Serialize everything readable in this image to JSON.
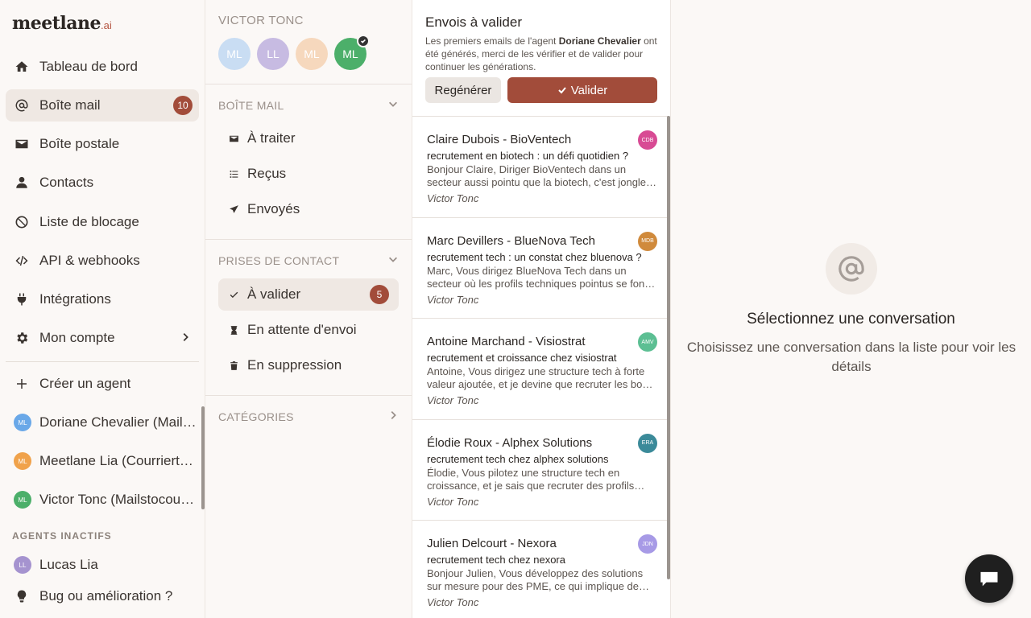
{
  "brand": {
    "name": "meetlane",
    "suffix": ".ai"
  },
  "sidebar": {
    "nav": [
      {
        "label": "Tableau de bord",
        "icon": "home-icon"
      },
      {
        "label": "Boîte mail",
        "icon": "at-icon",
        "badge": "10"
      },
      {
        "label": "Boîte postale",
        "icon": "mail-icon"
      },
      {
        "label": "Contacts",
        "icon": "user-icon"
      },
      {
        "label": "Liste de blocage",
        "icon": "block-icon"
      },
      {
        "label": "API & webhooks",
        "icon": "code-icon"
      },
      {
        "label": "Intégrations",
        "icon": "plug-icon"
      },
      {
        "label": "Mon compte",
        "icon": "gear-icon"
      }
    ],
    "create_agent": "Créer un agent",
    "agents": [
      {
        "initials": "ML",
        "label": "Doriane Chevalier (Mailstocoucou)",
        "color": "#6aa8e8"
      },
      {
        "initials": "ML",
        "label": "Meetlane Lia (Courriertech)",
        "color": "#f0a24b"
      },
      {
        "initials": "ML",
        "label": "Victor Tonc (Mailstocoucou)",
        "color": "#4caf6a"
      }
    ],
    "inactive_caption": "AGENTS INACTIFS",
    "inactive_agents": [
      {
        "initials": "LL",
        "label": "Lucas Lia",
        "color": "#a593cf"
      }
    ],
    "feedback": "Bug ou amélioration ?"
  },
  "panel": {
    "title": "VICTOR TONC",
    "avatars": [
      {
        "initials": "ML",
        "color": "#c9ddf3"
      },
      {
        "initials": "LL",
        "color": "#c7bbe2"
      },
      {
        "initials": "ML",
        "color": "#f6d8bd"
      },
      {
        "initials": "ML",
        "color": "#4caf6a"
      }
    ],
    "mailbox_caption": "BOÎTE MAIL",
    "mailbox_items": [
      "À traiter",
      "Reçus",
      "Envoyés"
    ],
    "contacts_caption": "PRISES DE CONTACT",
    "contact_items": [
      {
        "label": "À valider",
        "badge": "5"
      },
      {
        "label": "En attente d'envoi"
      },
      {
        "label": "En suppression"
      }
    ],
    "categories_caption": "CATÉGORIES"
  },
  "validation": {
    "title": "Envois à valider",
    "desc_before": "Les premiers emails de l'agent ",
    "desc_agent": "Doriane Chevalier",
    "desc_after": " ont été générés, merci de les vérifier et de valider pour continuer les générations.",
    "regen_label": "Regénérer",
    "validate_label": "Valider"
  },
  "mails": [
    {
      "from": "Claire Dubois - BioVentech",
      "subject": "recrutement en biotech : un défi quotidien ?",
      "preview": "Bonjour Claire, Diriger BioVentech dans un secteur aussi pointu que la biotech, c'est jongler avec des talents rares.",
      "signature": "Victor Tonc",
      "initials": "CDB",
      "color": "#d84b94"
    },
    {
      "from": "Marc Devillers - BlueNova Tech",
      "subject": "recrutement tech : un constat chez bluenova ?",
      "preview": "Marc, Vous dirigez BlueNova Tech dans un secteur où les profils techniques pointus se font rares.",
      "signature": "Victor Tonc",
      "initials": "MDB",
      "color": "#d08a3c"
    },
    {
      "from": "Antoine Marchand - Visiostrat",
      "subject": "recrutement et croissance chez visiostrat",
      "preview": "Antoine, Vous dirigez une structure tech à forte valeur ajoutée, et je devine que recruter les bons profils prend du temps.",
      "signature": "Victor Tonc",
      "initials": "AMV",
      "color": "#5cbf93"
    },
    {
      "from": "Élodie Roux - Alphex Solutions",
      "subject": "recrutement tech chez alphex solutions",
      "preview": "Élodie, Vous pilotez une structure tech en croissance, et je sais que recruter des profils qualifiés reste un défi.",
      "signature": "Victor Tonc",
      "initials": "ERA",
      "color": "#3b8a99"
    },
    {
      "from": "Julien Delcourt - Nexora",
      "subject": "recrutement tech chez nexora",
      "preview": "Bonjour Julien, Vous développez des solutions sur mesure pour des PME, ce qui implique de trouver des profils techniques.",
      "signature": "Victor Tonc",
      "initials": "JDN",
      "color": "#a79ae6"
    }
  ],
  "empty_state": {
    "title": "Sélectionnez une conversation",
    "subtitle": "Choisissez une conversation dans la liste pour voir les détails"
  },
  "colors": {
    "accent": "#a24c3a",
    "sidebar_bg": "#fbf8f6",
    "active_bg": "#efe8e3"
  }
}
